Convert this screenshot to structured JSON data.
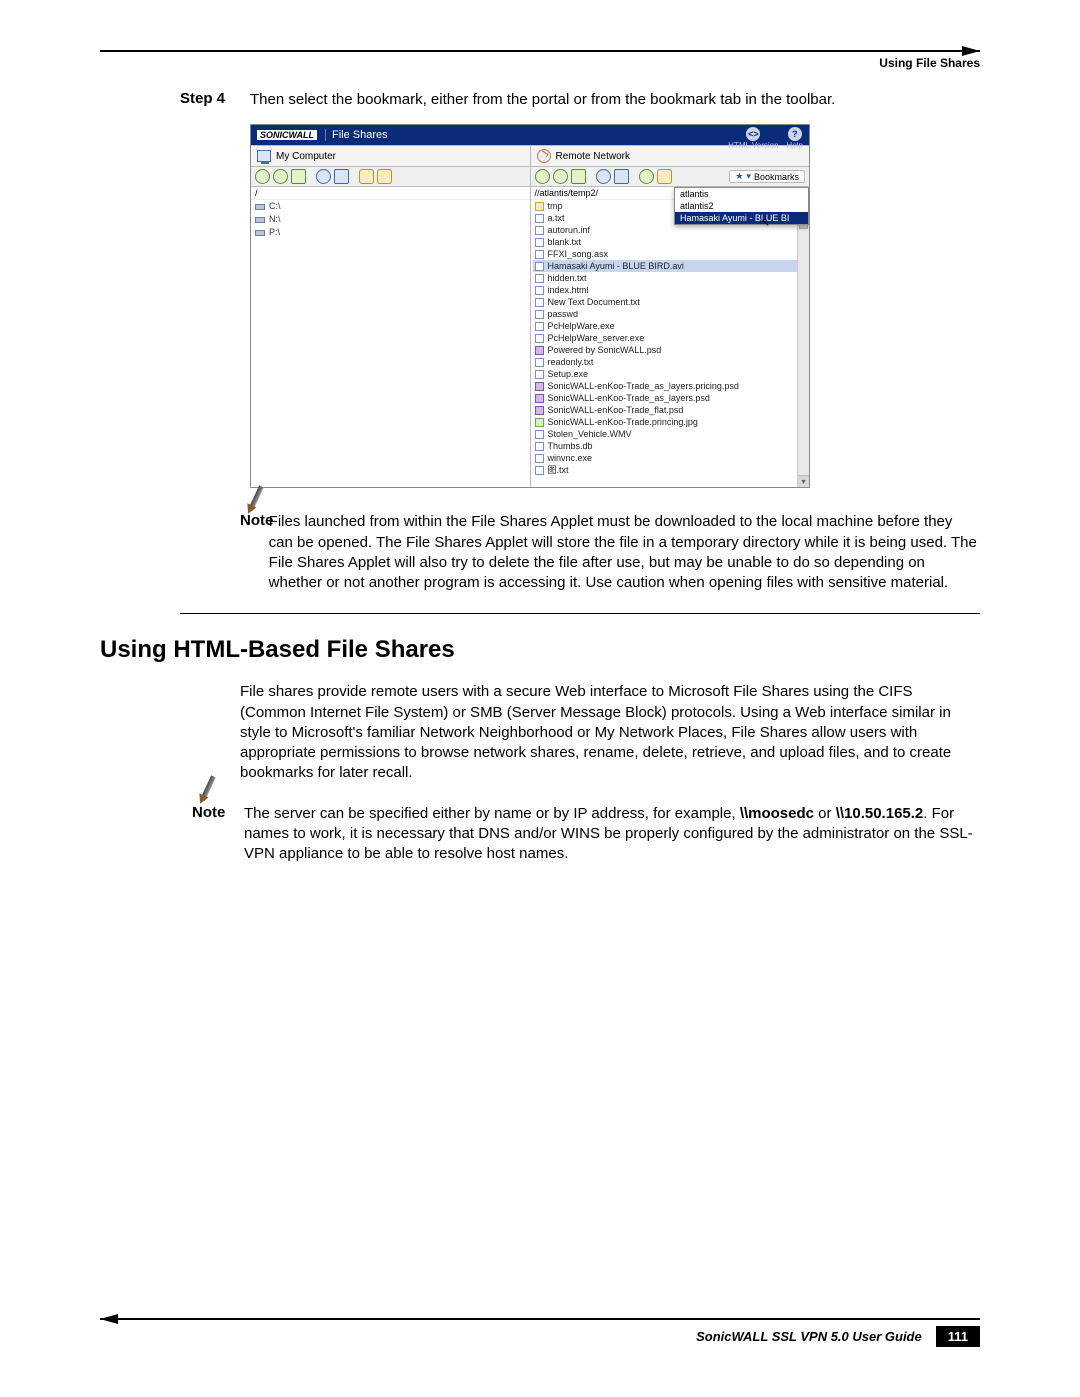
{
  "header": {
    "running_head": "Using File Shares"
  },
  "step4": {
    "label": "Step 4",
    "text": "Then select the bookmark, either from the portal or from the bookmark tab in the toolbar."
  },
  "screenshot": {
    "brand": "SONICWALL",
    "title": "File Shares",
    "top_right": {
      "btn1_label": "HTML Version",
      "btn2_label": "Help"
    },
    "left_head": "My Computer",
    "right_head": "Remote Network",
    "bookmarks_chip": "Bookmarks",
    "left_root": "/",
    "drives": [
      "C:\\",
      "N:\\",
      "P:\\"
    ],
    "right_path": "//atlantis/temp2/",
    "files": [
      {
        "t": "f",
        "n": "tmp"
      },
      {
        "t": "d",
        "n": "a.txt"
      },
      {
        "t": "d",
        "n": "autorun.inf"
      },
      {
        "t": "d",
        "n": "blank.txt"
      },
      {
        "t": "d",
        "n": "FFXI_song.asx"
      },
      {
        "t": "sel",
        "n": "Hamasaki Ayumi - BLUE BIRD.avi"
      },
      {
        "t": "d",
        "n": "hidden.txt"
      },
      {
        "t": "d",
        "n": "index.html"
      },
      {
        "t": "d",
        "n": "New Text Document.txt"
      },
      {
        "t": "d",
        "n": "passwd"
      },
      {
        "t": "d",
        "n": "PcHelpWare.exe"
      },
      {
        "t": "d",
        "n": "PcHelpWare_server.exe"
      },
      {
        "t": "p",
        "n": "Powered by SonicWALL.psd"
      },
      {
        "t": "d",
        "n": "readonly.txt"
      },
      {
        "t": "d",
        "n": "Setup.exe"
      },
      {
        "t": "p",
        "n": "SonicWALL-enKoo-Trade_as_layers.pricing.psd"
      },
      {
        "t": "p",
        "n": "SonicWALL-enKoo-Trade_as_layers.psd"
      },
      {
        "t": "p",
        "n": "SonicWALL-enKoo-Trade_flat.psd"
      },
      {
        "t": "i",
        "n": "SonicWALL-enKoo-Trade.princing.jpg"
      },
      {
        "t": "d",
        "n": "Stolen_Vehicle.WMV"
      },
      {
        "t": "d",
        "n": "Thumbs.db"
      },
      {
        "t": "d",
        "n": "winvnc.exe"
      },
      {
        "t": "d",
        "n": "图.txt"
      }
    ],
    "bookmark_menu": {
      "items": [
        "atlantis",
        "atlantis2"
      ],
      "selected": "Hamasaki Ayumi - BLUE BI"
    }
  },
  "note1": {
    "label": "Note",
    "text": "Files launched from within the File Shares Applet must be downloaded to the local machine before they can be opened. The File Shares Applet will store the file in a temporary directory while it is being used. The File Shares Applet will also try to delete the file after use, but may be unable to do so depending on whether or not another program is accessing it. Use caution when opening files with sensitive material."
  },
  "section": {
    "heading": "Using HTML-Based File Shares",
    "para": "File shares provide remote users with a secure Web interface to Microsoft File Shares using the CIFS (Common Internet File System) or SMB (Server Message Block) protocols. Using a Web interface similar in style to Microsoft's familiar Network Neighborhood or My Network Places, File Shares allow users with appropriate permissions to browse network shares, rename, delete, retrieve, and upload files, and to create bookmarks for later recall."
  },
  "note2": {
    "label": "Note",
    "pre": "The server can be specified either by name or by IP address, for example, ",
    "b1": "\\\\moosedc",
    "mid": " or ",
    "b2": "\\\\10.50.165.2",
    "post": ". For names to work, it is necessary that DNS and/or WINS be properly configured by the administrator on the SSL-VPN appliance to be able to resolve host names."
  },
  "footer": {
    "guide": "SonicWALL SSL VPN 5.0 User Guide",
    "page": "111"
  }
}
